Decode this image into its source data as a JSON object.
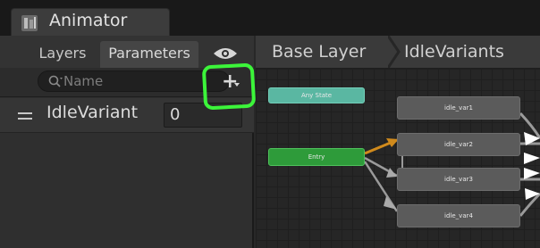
{
  "window": {
    "title": "Animator",
    "icon": "animator-icon"
  },
  "left_panel": {
    "tabs": [
      {
        "label": "Layers",
        "active": false
      },
      {
        "label": "Parameters",
        "active": true
      }
    ],
    "visibility_icon": "eye-icon",
    "search": {
      "placeholder": "Name",
      "value": ""
    },
    "add_parameter_symbol": "+",
    "parameters": [
      {
        "name": "IdleVariant",
        "value": "0"
      }
    ]
  },
  "breadcrumb": {
    "items": [
      "Base Layer",
      "IdleVariants"
    ]
  },
  "graph": {
    "any_state": "Any State",
    "entry": "Entry",
    "states": [
      "idle_var1",
      "idle_var2",
      "idle_var3",
      "idle_var4"
    ]
  },
  "colors": {
    "highlight": "#3cf53a",
    "any_state_node": "#5ab7a2",
    "entry_node": "#2e9b3a",
    "state_node": "#5b5b5b",
    "default_transition": "#d08a1c"
  }
}
